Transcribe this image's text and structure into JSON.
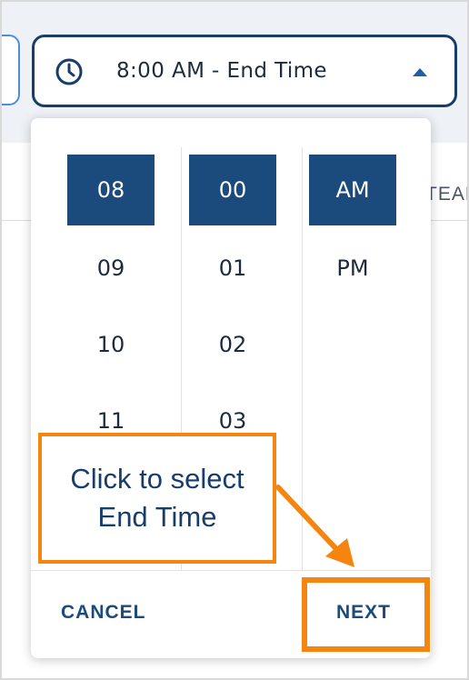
{
  "time_field": {
    "value": "8:00 AM - End Time",
    "icon": "clock-icon",
    "toggle_icon": "caret-up-icon"
  },
  "background": {
    "partial_column_label": "TEAM"
  },
  "picker": {
    "hours": [
      "08",
      "09",
      "10",
      "11"
    ],
    "minutes": [
      "00",
      "01",
      "02",
      "03"
    ],
    "periods": [
      "AM",
      "PM"
    ],
    "selected_hour": "08",
    "selected_minute": "00",
    "selected_period": "AM"
  },
  "footer": {
    "cancel_label": "CANCEL",
    "next_label": "NEXT"
  },
  "annotation": {
    "callout_line1": "Click to select",
    "callout_line2": "End Time",
    "highlight_color": "#f5850f"
  },
  "colors": {
    "field_border": "#173e6b",
    "selected_bg": "#1b4a7c",
    "button_text": "#1b4a7c",
    "annotation": "#f5850f"
  }
}
